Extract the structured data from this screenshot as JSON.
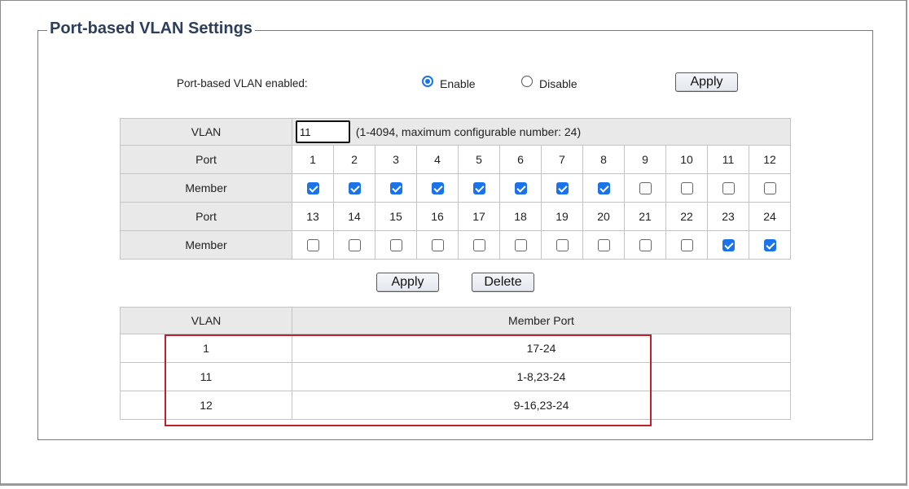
{
  "legend": "Port-based VLAN Settings",
  "enable_setting": {
    "label": "Port-based VLAN enabled:",
    "options": [
      {
        "label": "Enable",
        "selected": true
      },
      {
        "label": "Disable",
        "selected": false
      }
    ],
    "apply_label": "Apply"
  },
  "vlan_config": {
    "vlan_label": "VLAN",
    "vlan_value": "11",
    "vlan_hint": "(1-4094, maximum configurable number: 24)",
    "port_label": "Port",
    "member_label": "Member",
    "ports_row1": [
      "1",
      "2",
      "3",
      "4",
      "5",
      "6",
      "7",
      "8",
      "9",
      "10",
      "11",
      "12"
    ],
    "members_row1": [
      true,
      true,
      true,
      true,
      true,
      true,
      true,
      true,
      false,
      false,
      false,
      false
    ],
    "ports_row2": [
      "13",
      "14",
      "15",
      "16",
      "17",
      "18",
      "19",
      "20",
      "21",
      "22",
      "23",
      "24"
    ],
    "members_row2": [
      false,
      false,
      false,
      false,
      false,
      false,
      false,
      false,
      false,
      false,
      true,
      true
    ]
  },
  "actions": {
    "apply_label": "Apply",
    "delete_label": "Delete"
  },
  "vlan_table": {
    "headers": {
      "vlan": "VLAN",
      "member_port": "Member Port"
    },
    "rows": [
      {
        "vlan": "1",
        "member_port": "17-24"
      },
      {
        "vlan": "11",
        "member_port": "1-8,23-24"
      },
      {
        "vlan": "12",
        "member_port": "9-16,23-24"
      }
    ]
  },
  "colors": {
    "accent": "#1a73e8",
    "highlight": "#c0202a",
    "legend_text": "#2d3e5a"
  }
}
